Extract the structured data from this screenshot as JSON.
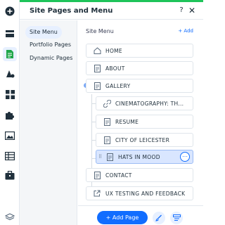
{
  "panel": {
    "title": "Site Pages and Menu",
    "help_label": "?",
    "close_label": "✕"
  },
  "rail": {
    "icons": [
      "add-icon",
      "sections-icon",
      "pages-icon",
      "design-icon",
      "apps-icon",
      "puzzle-icon",
      "media-icon",
      "table-icon",
      "business-icon",
      "layers-icon"
    ],
    "active_icon": "pages-icon"
  },
  "subnav": {
    "items": [
      {
        "label": "Site Menu",
        "active": true
      },
      {
        "label": "Portfolio Pages",
        "active": false
      },
      {
        "label": "Dynamic Pages",
        "active": false
      }
    ]
  },
  "main": {
    "title": "Site Menu",
    "add_label": "+ Add"
  },
  "pages": [
    {
      "label": "HOME",
      "icon": "home-icon",
      "level": 0
    },
    {
      "label": "ABOUT",
      "icon": "page-icon",
      "level": 0
    },
    {
      "label": "GALLERY",
      "icon": "page-icon",
      "level": 0
    },
    {
      "label": "CINEMATOGRAPHY: TH...",
      "icon": "link-icon",
      "level": 1
    },
    {
      "label": "RESUME",
      "icon": "page-icon",
      "level": 1
    },
    {
      "label": "CITY OF LEICESTER",
      "icon": "page-icon",
      "level": 1
    },
    {
      "label": "HATS IN MOOD",
      "icon": "page-icon",
      "level": 1,
      "selected": true
    },
    {
      "label": "CONTACT",
      "icon": "page-icon",
      "level": 0
    },
    {
      "label": "UX TESTING AND FEEDBACK",
      "icon": "external-link-icon",
      "level": 0
    }
  ],
  "footer": {
    "add_page_label": "+ Add Page"
  },
  "colors": {
    "accent_green": "#1ec45a",
    "primary_blue": "#116dff",
    "selected_bg": "#d9e6ff"
  }
}
